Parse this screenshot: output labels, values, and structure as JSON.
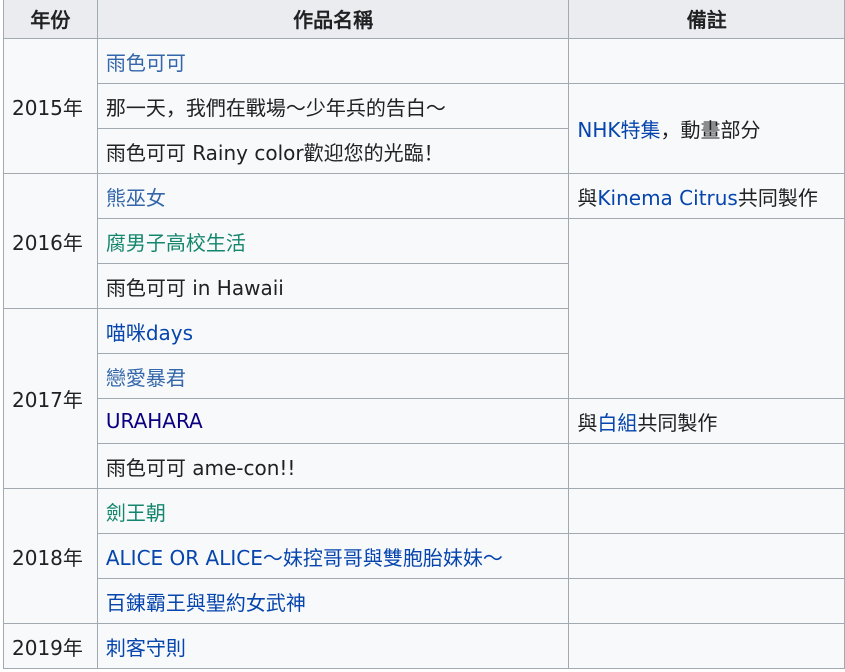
{
  "headers": {
    "year": "年份",
    "title": "作品名稱",
    "note": "備註"
  },
  "years": {
    "y2015": "2015年",
    "y2016": "2016年",
    "y2017": "2017年",
    "y2018": "2018年",
    "y2019": "2019年"
  },
  "works": {
    "w1": "雨色可可",
    "w2": "那一天，我們在戰場～少年兵的告白～",
    "w3": "雨色可可 Rainy color歡迎您的光臨！",
    "w4": "熊巫女",
    "w5": "腐男子高校生活",
    "w6": "雨色可可 in Hawaii",
    "w7": "喵咪days",
    "w8": "戀愛暴君",
    "w9": "URAHARA",
    "w10": "雨色可可 ame-con!!",
    "w11": "劍王朝",
    "w12": "ALICE OR ALICE～妹控哥哥與雙胞胎妹妹～",
    "w13": "百錬霸王與聖約女武神",
    "w14": "刺客守則"
  },
  "notes": {
    "n1_link": "NHK特集",
    "n1_text": "，動畫部分",
    "n2_pre": "與",
    "n2_link": "Kinema Citrus",
    "n2_post": "共同製作",
    "n3_pre": "與",
    "n3_link": "白組",
    "n3_post": "共同製作"
  },
  "colors": {
    "link": "#0645ad",
    "visited": "#0b0080",
    "teal": "#14866d",
    "border": "#a2a9b1",
    "header_bg": "#eaecf0",
    "cell_bg": "#f8f9fa"
  }
}
